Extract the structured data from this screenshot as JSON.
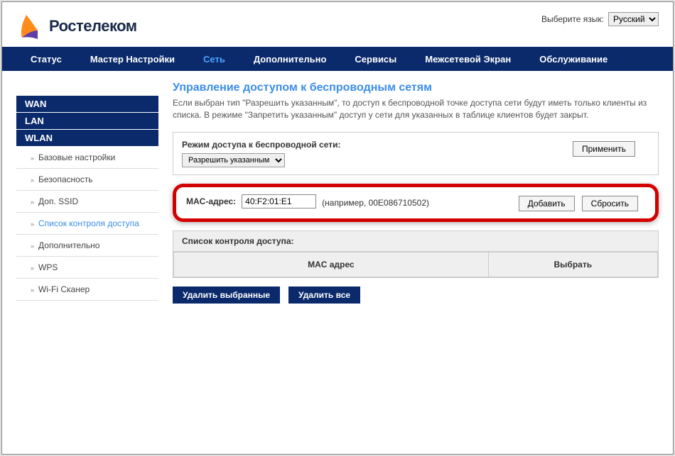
{
  "header": {
    "logo_text": "Ростелеком",
    "lang_label": "Выберите язык:",
    "lang_value": "Русский"
  },
  "nav": {
    "status": "Статус",
    "wizard": "Мастер Настройки",
    "network": "Сеть",
    "advanced": "Дополнительно",
    "services": "Сервисы",
    "firewall": "Межсетевой Экран",
    "maintenance": "Обслуживание"
  },
  "sidebar": {
    "wan": "WAN",
    "lan": "LAN",
    "wlan": "WLAN",
    "items": [
      {
        "label": "Базовые настройки"
      },
      {
        "label": "Безопасность"
      },
      {
        "label": "Доп. SSID"
      },
      {
        "label": "Список контроля доступа"
      },
      {
        "label": "Дополнительно"
      },
      {
        "label": "WPS"
      },
      {
        "label": "Wi-Fi Сканер"
      }
    ]
  },
  "page": {
    "title": "Управление доступом к беспроводным сетям",
    "desc": "Если выбран тип \"Разрешить указанным\", то доступ к беспроводной точке доступа сети будут иметь только клиенты из списка. В режиме \"Запретить указанным\" доступ у сети для указанных в таблице клиентов будет закрыт."
  },
  "mode_panel": {
    "head": "Режим доступа к беспроводной сети:",
    "select_value": "Разрешить указанным",
    "apply": "Применить"
  },
  "mac_panel": {
    "label": "MAC-адрес:",
    "value": "40:F2:01:E1",
    "hint": "(например, 00E086710502)",
    "add": "Добавить",
    "reset": "Сбросить"
  },
  "acl_panel": {
    "head": "Список контроля доступа:",
    "col_mac": "MAC адрес",
    "col_select": "Выбрать"
  },
  "actions": {
    "delete_selected": "Удалить выбранные",
    "delete_all": "Удалить все"
  }
}
